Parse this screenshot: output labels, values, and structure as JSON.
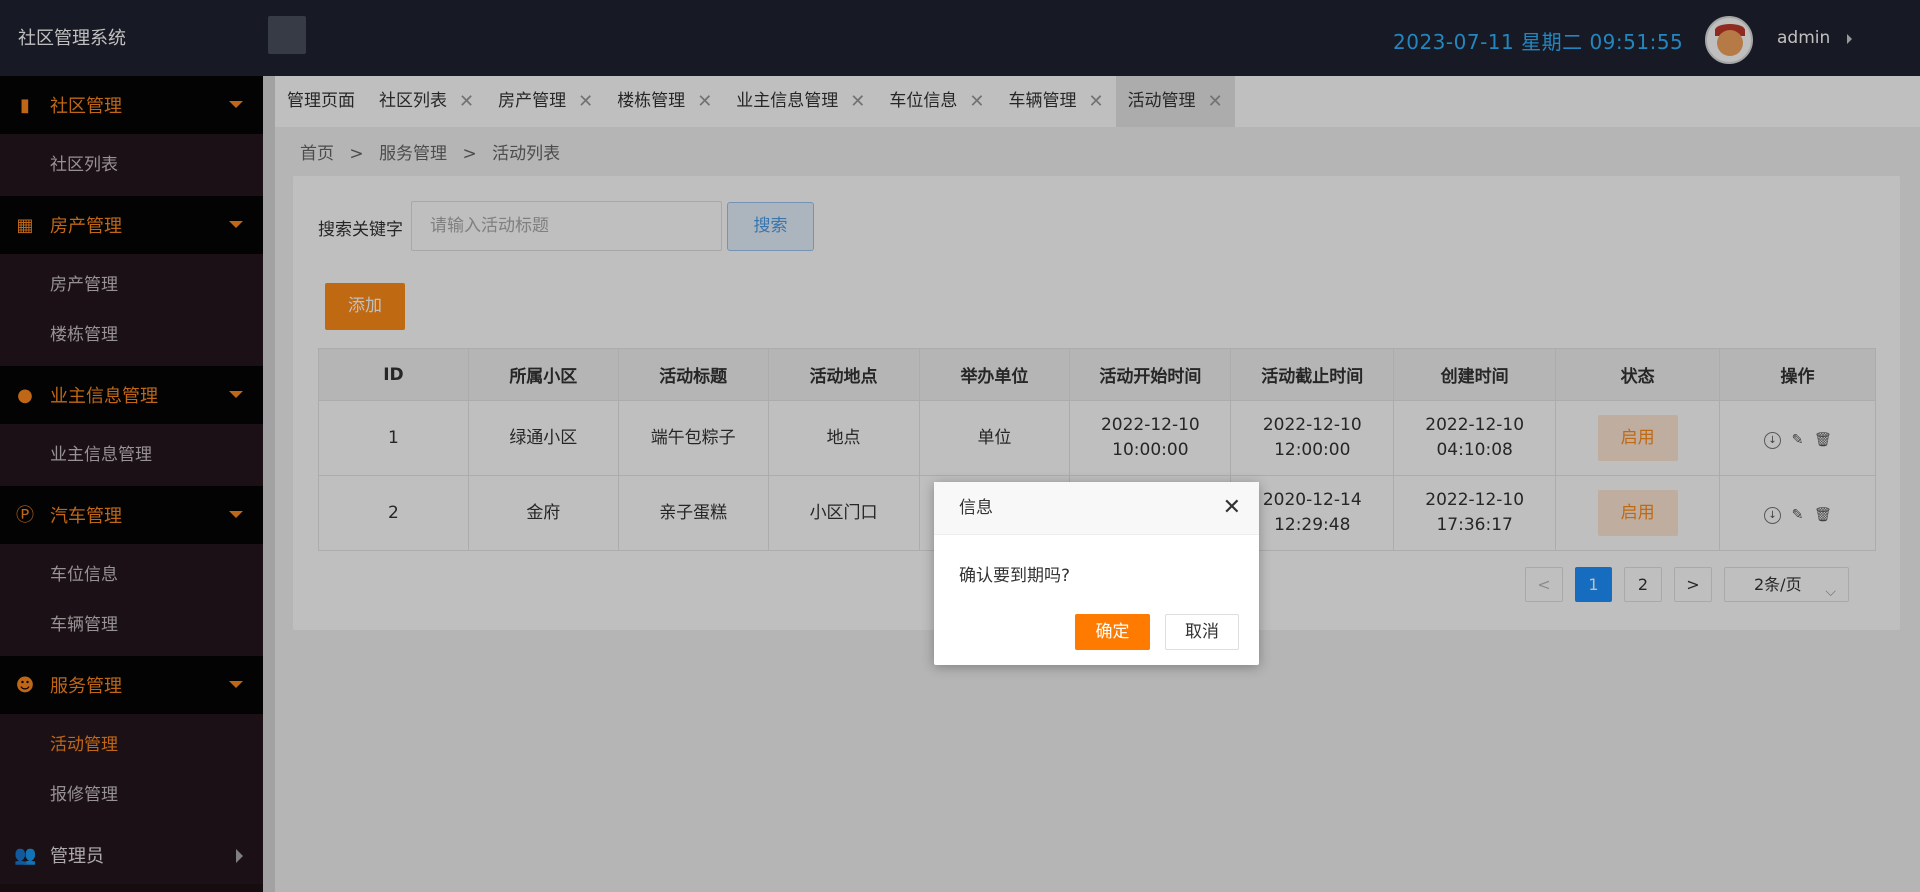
{
  "header": {
    "app_title": "社区管理系统",
    "datetime": "2023-07-11  星期二  09:51:55",
    "username": "admin"
  },
  "sidebar": {
    "groups": [
      {
        "label": "社区管理",
        "icon": "building-icon",
        "items": [
          {
            "label": "社区列表"
          }
        ]
      },
      {
        "label": "房产管理",
        "icon": "city-icon",
        "items": [
          {
            "label": "房产管理"
          },
          {
            "label": "楼栋管理"
          }
        ]
      },
      {
        "label": "业主信息管理",
        "icon": "user-icon",
        "items": [
          {
            "label": "业主信息管理"
          }
        ]
      },
      {
        "label": "汽车管理",
        "icon": "parking-icon",
        "items": [
          {
            "label": "车位信息"
          },
          {
            "label": "车辆管理"
          }
        ]
      },
      {
        "label": "服务管理",
        "icon": "service-icon",
        "items": [
          {
            "label": "活动管理"
          },
          {
            "label": "报修管理"
          }
        ]
      },
      {
        "label": "管理员",
        "icon": "admins-icon",
        "items": []
      }
    ]
  },
  "tabs": [
    {
      "label": "管理页面"
    },
    {
      "label": "社区列表"
    },
    {
      "label": "房产管理"
    },
    {
      "label": "楼栋管理"
    },
    {
      "label": "业主信息管理"
    },
    {
      "label": "车位信息"
    },
    {
      "label": "车辆管理"
    },
    {
      "label": "活动管理"
    }
  ],
  "breadcrumb": {
    "home": "首页",
    "section": "服务管理",
    "page": "活动列表",
    "sep": ">"
  },
  "search": {
    "label": "搜索关键字",
    "placeholder": "请输入活动标题",
    "button": "搜索"
  },
  "add_button": "添加",
  "table": {
    "columns": [
      "ID",
      "所属小区",
      "活动标题",
      "活动地点",
      "举办单位",
      "活动开始时间",
      "活动截止时间",
      "创建时间",
      "状态",
      "操作"
    ],
    "rows": [
      {
        "id": "1",
        "community": "绿通小区",
        "title": "端午包粽子",
        "place": "地点",
        "org": "单位",
        "start_date": "2022-12-10",
        "start_time": "10:00:00",
        "end_date": "2022-12-10",
        "end_time": "12:00:00",
        "created_date": "2022-12-10",
        "created_time": "04:10:08",
        "status": "启用"
      },
      {
        "id": "2",
        "community": "金府",
        "title": "亲子蛋糕",
        "place": "小区门口",
        "org": "",
        "start_date": "",
        "start_time": "",
        "end_date": "2020-12-14",
        "end_time": "12:29:48",
        "created_date": "2022-12-10",
        "created_time": "17:36:17",
        "status": "启用"
      }
    ]
  },
  "pagination": {
    "prev": "<",
    "pages": [
      "1",
      "2"
    ],
    "next": ">",
    "page_size": "2条/页",
    "current": "1"
  },
  "dialog": {
    "title": "信息",
    "message": "确认要到期吗?",
    "ok": "确定",
    "cancel": "取消"
  },
  "colors": {
    "accent": "#ff8a1e",
    "primary": "#1e90ff",
    "topbar": "#1f2331",
    "datetime": "#2fb3ff"
  }
}
